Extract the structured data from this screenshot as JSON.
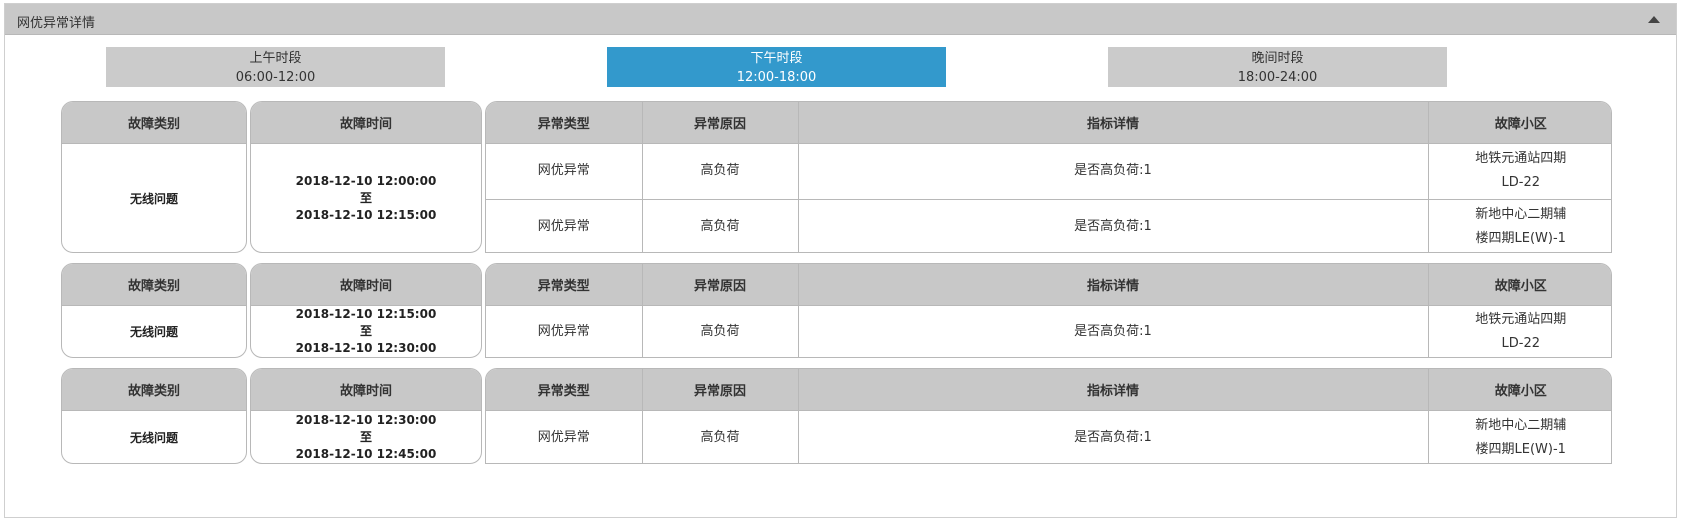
{
  "panel": {
    "title": "网优异常详情"
  },
  "tabs": [
    {
      "name": "上午时段",
      "range": "06:00-12:00",
      "active": false
    },
    {
      "name": "下午时段",
      "range": "12:00-18:00",
      "active": true
    },
    {
      "name": "晚间时段",
      "range": "18:00-24:00",
      "active": false
    }
  ],
  "headers": {
    "category": "故障类别",
    "time": "故障时间",
    "type": "异常类型",
    "reason": "异常原因",
    "detail": "指标详情",
    "cell": "故障小区"
  },
  "groups": [
    {
      "category": "无线问题",
      "time_start": "2018-12-10 12:00:00",
      "to": "至",
      "time_end": "2018-12-10 12:15:00",
      "rows": [
        {
          "type": "网优异常",
          "reason": "高负荷",
          "detail": "是否高负荷:1",
          "cell_line1": "地铁元通站四期",
          "cell_line2": "LD-22"
        },
        {
          "type": "网优异常",
          "reason": "高负荷",
          "detail": "是否高负荷:1",
          "cell_line1": "新地中心二期辅",
          "cell_line2": "楼四期LE(W)-1"
        }
      ]
    },
    {
      "category": "无线问题",
      "time_start": "2018-12-10 12:15:00",
      "to": "至",
      "time_end": "2018-12-10 12:30:00",
      "rows": [
        {
          "type": "网优异常",
          "reason": "高负荷",
          "detail": "是否高负荷:1",
          "cell_line1": "地铁元通站四期",
          "cell_line2": "LD-22"
        }
      ]
    },
    {
      "category": "无线问题",
      "time_start": "2018-12-10 12:30:00",
      "to": "至",
      "time_end": "2018-12-10 12:45:00",
      "rows": [
        {
          "type": "网优异常",
          "reason": "高负荷",
          "detail": "是否高负荷:1",
          "cell_line1": "新地中心二期辅",
          "cell_line2": "楼四期LE(W)-1"
        }
      ]
    }
  ]
}
